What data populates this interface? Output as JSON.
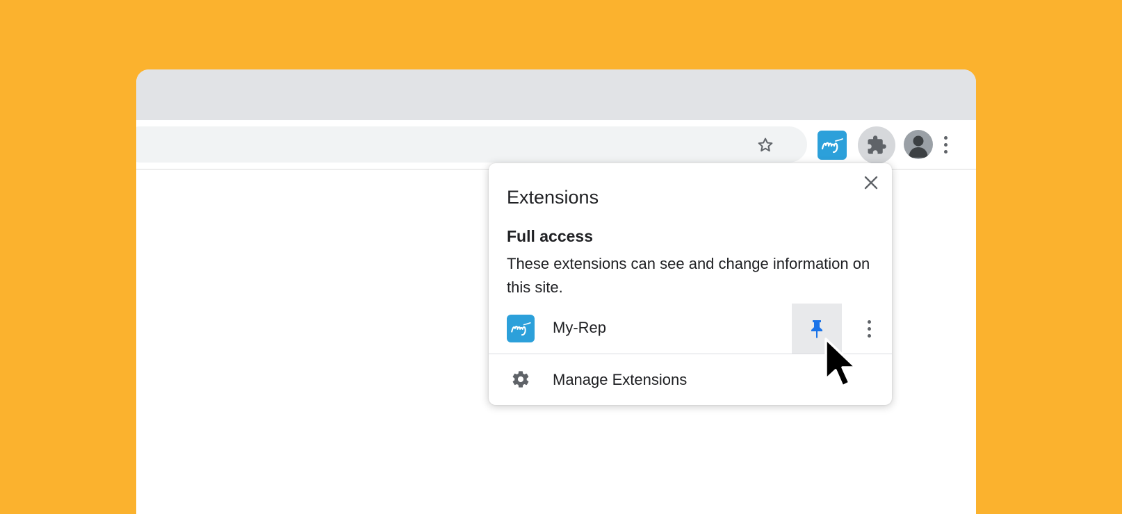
{
  "colors": {
    "background": "#FBB22E",
    "tabstrip": "#E1E3E6",
    "brand": "#2CA0DA",
    "pin_active": "#1A73E8",
    "text": "#202124"
  },
  "toolbar": {
    "bookmark_icon": "star-outline-icon",
    "extension_icon": "my-rep-logo",
    "extensions_button_icon": "puzzle-piece-icon",
    "profile_icon": "avatar-icon",
    "menu_icon": "vertical-dots-icon"
  },
  "popup": {
    "title": "Extensions",
    "close_icon": "close-icon",
    "section_heading": "Full access",
    "section_description": "These extensions can see and change information on this site.",
    "extensions": [
      {
        "name": "My-Rep",
        "logo_text": "my",
        "pinned": true,
        "pin_icon": "pin-icon",
        "more_icon": "vertical-dots-icon"
      }
    ],
    "manage_label": "Manage Extensions",
    "manage_icon": "gear-icon"
  }
}
